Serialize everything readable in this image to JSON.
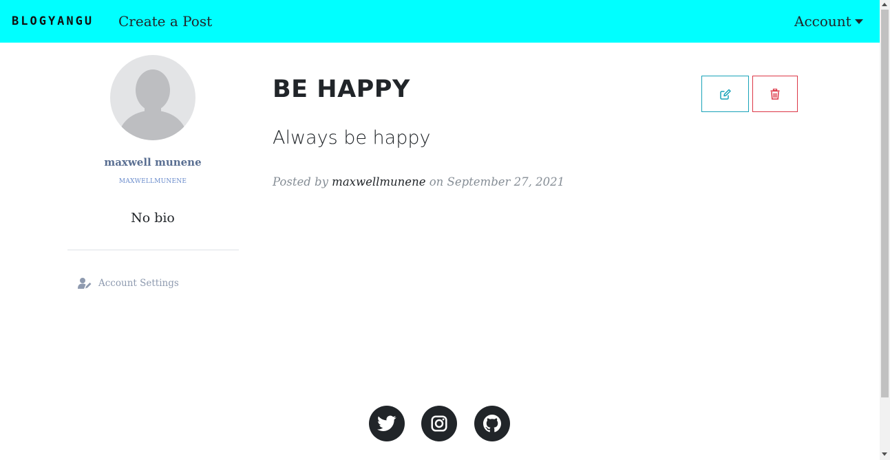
{
  "navbar": {
    "brand": "BLOGYANGU",
    "create_post": "Create a Post",
    "account": "Account",
    "background_color": "#00ffff"
  },
  "sidebar": {
    "avatar_icon": "user-silhouette-icon",
    "name": "maxwell munene",
    "username": "MAXWELLMUNENE",
    "bio": "No bio",
    "settings": {
      "icon": "user-edit-icon",
      "label": "Account Settings"
    }
  },
  "post": {
    "title": "BE HAPPY",
    "body": "Always be happy",
    "meta_prefix": "Posted by",
    "author": "maxwellmunene",
    "meta_on": "on",
    "date": "September 27, 2021",
    "actions": {
      "edit_icon": "edit-icon",
      "delete_icon": "trash-icon",
      "edit_color": "#17a2b8",
      "delete_color": "#dc3545"
    }
  },
  "footer": {
    "social": [
      {
        "icon": "twitter-icon"
      },
      {
        "icon": "instagram-icon"
      },
      {
        "icon": "github-icon"
      }
    ]
  }
}
